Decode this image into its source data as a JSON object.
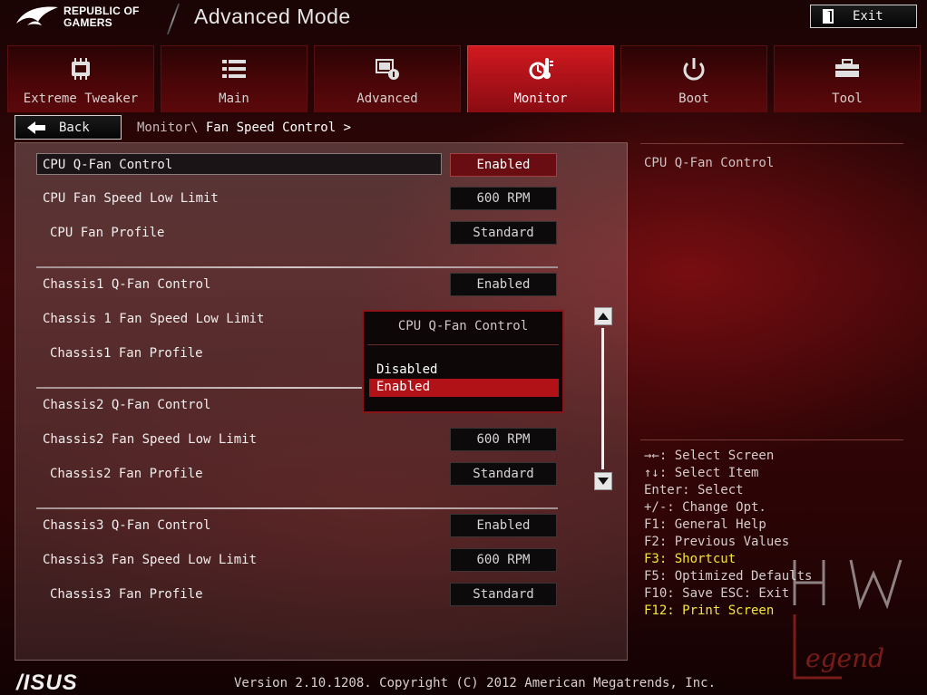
{
  "header": {
    "brand": "REPUBLIC OF GAMERS",
    "brand_line1": "REPUBLIC OF",
    "brand_line2": "GAMERS",
    "title": "Advanced Mode",
    "exit_label": "Exit"
  },
  "tabs": [
    {
      "label": "Extreme Tweaker",
      "icon": "tweaker-icon",
      "active": false
    },
    {
      "label": "Main",
      "icon": "list-icon",
      "active": false
    },
    {
      "label": "Advanced",
      "icon": "advanced-icon",
      "active": false
    },
    {
      "label": "Monitor",
      "icon": "monitor-icon",
      "active": true
    },
    {
      "label": "Boot",
      "icon": "power-icon",
      "active": false
    },
    {
      "label": "Tool",
      "icon": "tool-icon",
      "active": false
    }
  ],
  "nav": {
    "back_label": "Back",
    "breadcrumb_parent": "Monitor\\",
    "breadcrumb_current": "Fan Speed Control >"
  },
  "settings": [
    {
      "label": "CPU Q-Fan Control",
      "value": "Enabled",
      "selected": true
    },
    {
      "label": "CPU Fan Speed Low Limit",
      "value": "600 RPM"
    },
    {
      "label": "CPU Fan Profile",
      "value": "Standard"
    },
    {
      "label": "Chassis1 Q-Fan Control",
      "value": "Enabled"
    },
    {
      "label": "Chassis 1 Fan Speed Low Limit",
      "value": ""
    },
    {
      "label": "Chassis1 Fan Profile",
      "value": ""
    },
    {
      "label": "Chassis2 Q-Fan Control",
      "value": ""
    },
    {
      "label": "Chassis2 Fan Speed Low Limit",
      "value": "600 RPM"
    },
    {
      "label": "Chassis2 Fan Profile",
      "value": "Standard"
    },
    {
      "label": "Chassis3 Q-Fan Control",
      "value": "Enabled"
    },
    {
      "label": "Chassis3 Fan Speed Low Limit",
      "value": "600 RPM"
    },
    {
      "label": "Chassis3 Fan Profile",
      "value": "Standard"
    }
  ],
  "popup": {
    "title": "CPU Q-Fan Control",
    "options": [
      "Disabled",
      "Enabled"
    ],
    "selected": "Enabled"
  },
  "help": {
    "title": "CPU Q-Fan Control",
    "keys": [
      "→←: Select Screen",
      "↑↓: Select Item",
      "Enter: Select",
      "+/-: Change Opt.",
      "F1: General Help",
      "F2: Previous Values",
      "F3: Shortcut",
      "F5: Optimized Defaults",
      "F10: Save  ESC: Exit",
      "F12: Print Screen"
    ]
  },
  "footer": {
    "brand": "/ISUS",
    "version": "Version 2.10.1208. Copyright (C) 2012 American Megatrends, Inc."
  },
  "colors": {
    "accent": "#b01217",
    "shortcut_yellow": "#f5e53a"
  }
}
